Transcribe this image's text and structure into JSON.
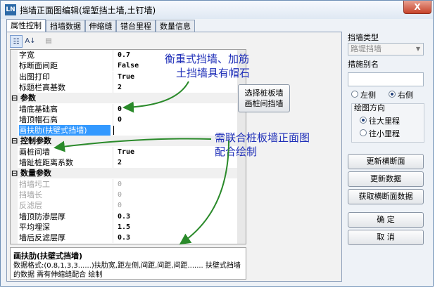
{
  "window": {
    "title": "挡墙正面图编辑(堤堑挡土墙,土钉墙)",
    "app_icon": "ln-app-icon",
    "close_label": "X"
  },
  "tabs": [
    {
      "label": "属性控制",
      "active": true
    },
    {
      "label": "挡墙数据",
      "active": false
    },
    {
      "label": "伸缩缝",
      "active": false
    },
    {
      "label": "错台里程",
      "active": false
    },
    {
      "label": "数量信息",
      "active": false
    }
  ],
  "toolbar": {
    "categorized_icon": "categorized-icon",
    "sort_icon": "sort-az-icon",
    "pages_icon": "property-pages-icon"
  },
  "properties": [
    {
      "type": "row",
      "name": "字宽",
      "value": "0.7"
    },
    {
      "type": "row",
      "name": "标断面间距",
      "value": "False"
    },
    {
      "type": "row",
      "name": "出图打印",
      "value": "True"
    },
    {
      "type": "row",
      "name": "标题栏高基数",
      "value": "2"
    },
    {
      "type": "cat",
      "name": "参数",
      "toggle": "⊟"
    },
    {
      "type": "row",
      "name": "墙底基础高",
      "value": "0"
    },
    {
      "type": "row",
      "name": "墙顶帽石高",
      "value": "0"
    },
    {
      "type": "sel",
      "name": "画扶肋(扶壁式挡墙)",
      "value": ""
    },
    {
      "type": "cat",
      "name": "控制参数",
      "toggle": "⊟"
    },
    {
      "type": "row",
      "name": "画桩间墙",
      "value": "True"
    },
    {
      "type": "row",
      "name": "墙趾桩距离系数",
      "value": "2"
    },
    {
      "type": "cat",
      "name": "数量参数",
      "toggle": "⊟"
    },
    {
      "type": "dis",
      "name": "挡墙圬工",
      "value": "0"
    },
    {
      "type": "dis",
      "name": "挡墙长",
      "value": "0"
    },
    {
      "type": "dis",
      "name": "反滤层",
      "value": "0"
    },
    {
      "type": "row",
      "name": "墙顶防渗层厚",
      "value": "0.3"
    },
    {
      "type": "row",
      "name": "平均埋深",
      "value": "1.5"
    },
    {
      "type": "row",
      "name": "墙后反滤层厚",
      "value": "0.3"
    }
  ],
  "help": {
    "title": "画扶肋(扶壁式挡墙)",
    "text": "数据格式:(0.8,1,3,3......)扶肋宽,距左侧,间距,间距,间距....... 扶壁式挡墙的数据 需有伸缩缝配合 绘制"
  },
  "select_wall_button": "选择桩板墙\n画桩间挡墙",
  "right": {
    "wall_type_label": "挡墙类型",
    "wall_type_value": "路堤挡墙",
    "alias_label": "措施别名",
    "alias_value": "",
    "left_label": "左侧",
    "right_label": "右侧",
    "side_selected": "right",
    "direction_label": "绘图方向",
    "dir_big": "往大里程",
    "dir_small": "往小里程",
    "dir_selected": "big",
    "btn_update_section": "更新横断面",
    "btn_update_data": "更新数据",
    "btn_get_section": "获取横断面数据",
    "btn_ok": "确 定",
    "btn_cancel": "取 消"
  },
  "annotations": {
    "a1_line1": "衡重式挡墙、加筋",
    "a1_line2": "土挡墙具有帽石",
    "a2_line1": "需联合桩板墙正面图",
    "a2_line2": "配合绘制"
  },
  "colors": {
    "annotation": "#1f2fb8",
    "arrow": "#2a8a2a",
    "selected": "#3399ff"
  }
}
